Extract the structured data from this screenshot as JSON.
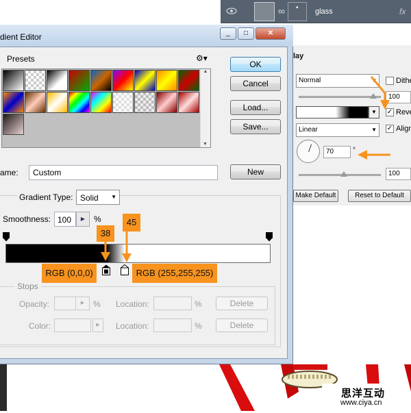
{
  "layers_panel": {
    "layer_name": "glass",
    "fx_label": "fx"
  },
  "layer_style": {
    "section_title": "lay",
    "blend_mode": "Normal",
    "dither_label": "Dithe",
    "opacity_value": "100",
    "reverse_label": "Reve",
    "reverse_checked": true,
    "style_value": "Linear",
    "align_label": "Align",
    "align_checked": true,
    "angle_value": "70",
    "degree_symbol": "°",
    "scale_value": "100",
    "make_default_label": "Make Default",
    "reset_default_label": "Reset to Default"
  },
  "dialog": {
    "title": "dient Editor",
    "window_buttons": [
      "_",
      "□",
      "✕"
    ],
    "presets_label": "Presets",
    "ok_label": "OK",
    "cancel_label": "Cancel",
    "load_label": "Load...",
    "save_label": "Save...",
    "name_label": "ame:",
    "name_value": "Custom",
    "new_label": "New",
    "gradient_type_label": "Gradient Type:",
    "gradient_type_value": "Solid",
    "smoothness_label": "Smoothness:",
    "smoothness_value": "100",
    "percent": "%",
    "stops_group_label": "Stops",
    "opacity_label": "Opacity:",
    "color_label": "Color:",
    "location_label": "Location:",
    "delete_label": "Delete"
  },
  "gradient": {
    "stops": [
      {
        "position_pct": 38,
        "color": "#000000"
      },
      {
        "position_pct": 45,
        "color": "#ffffff"
      }
    ]
  },
  "callouts": {
    "stop1_location": "38",
    "stop2_location": "45",
    "stop1_color": "RGB (0,0,0)",
    "stop2_color": "RGB (255,255,255)"
  },
  "watermark": {
    "brand": "思洋互动",
    "url": "www.ciya.cn"
  },
  "colors": {
    "accent": "#f7931e",
    "dialog_frame": "#c6d6e9",
    "layers_panel": "#566270"
  }
}
